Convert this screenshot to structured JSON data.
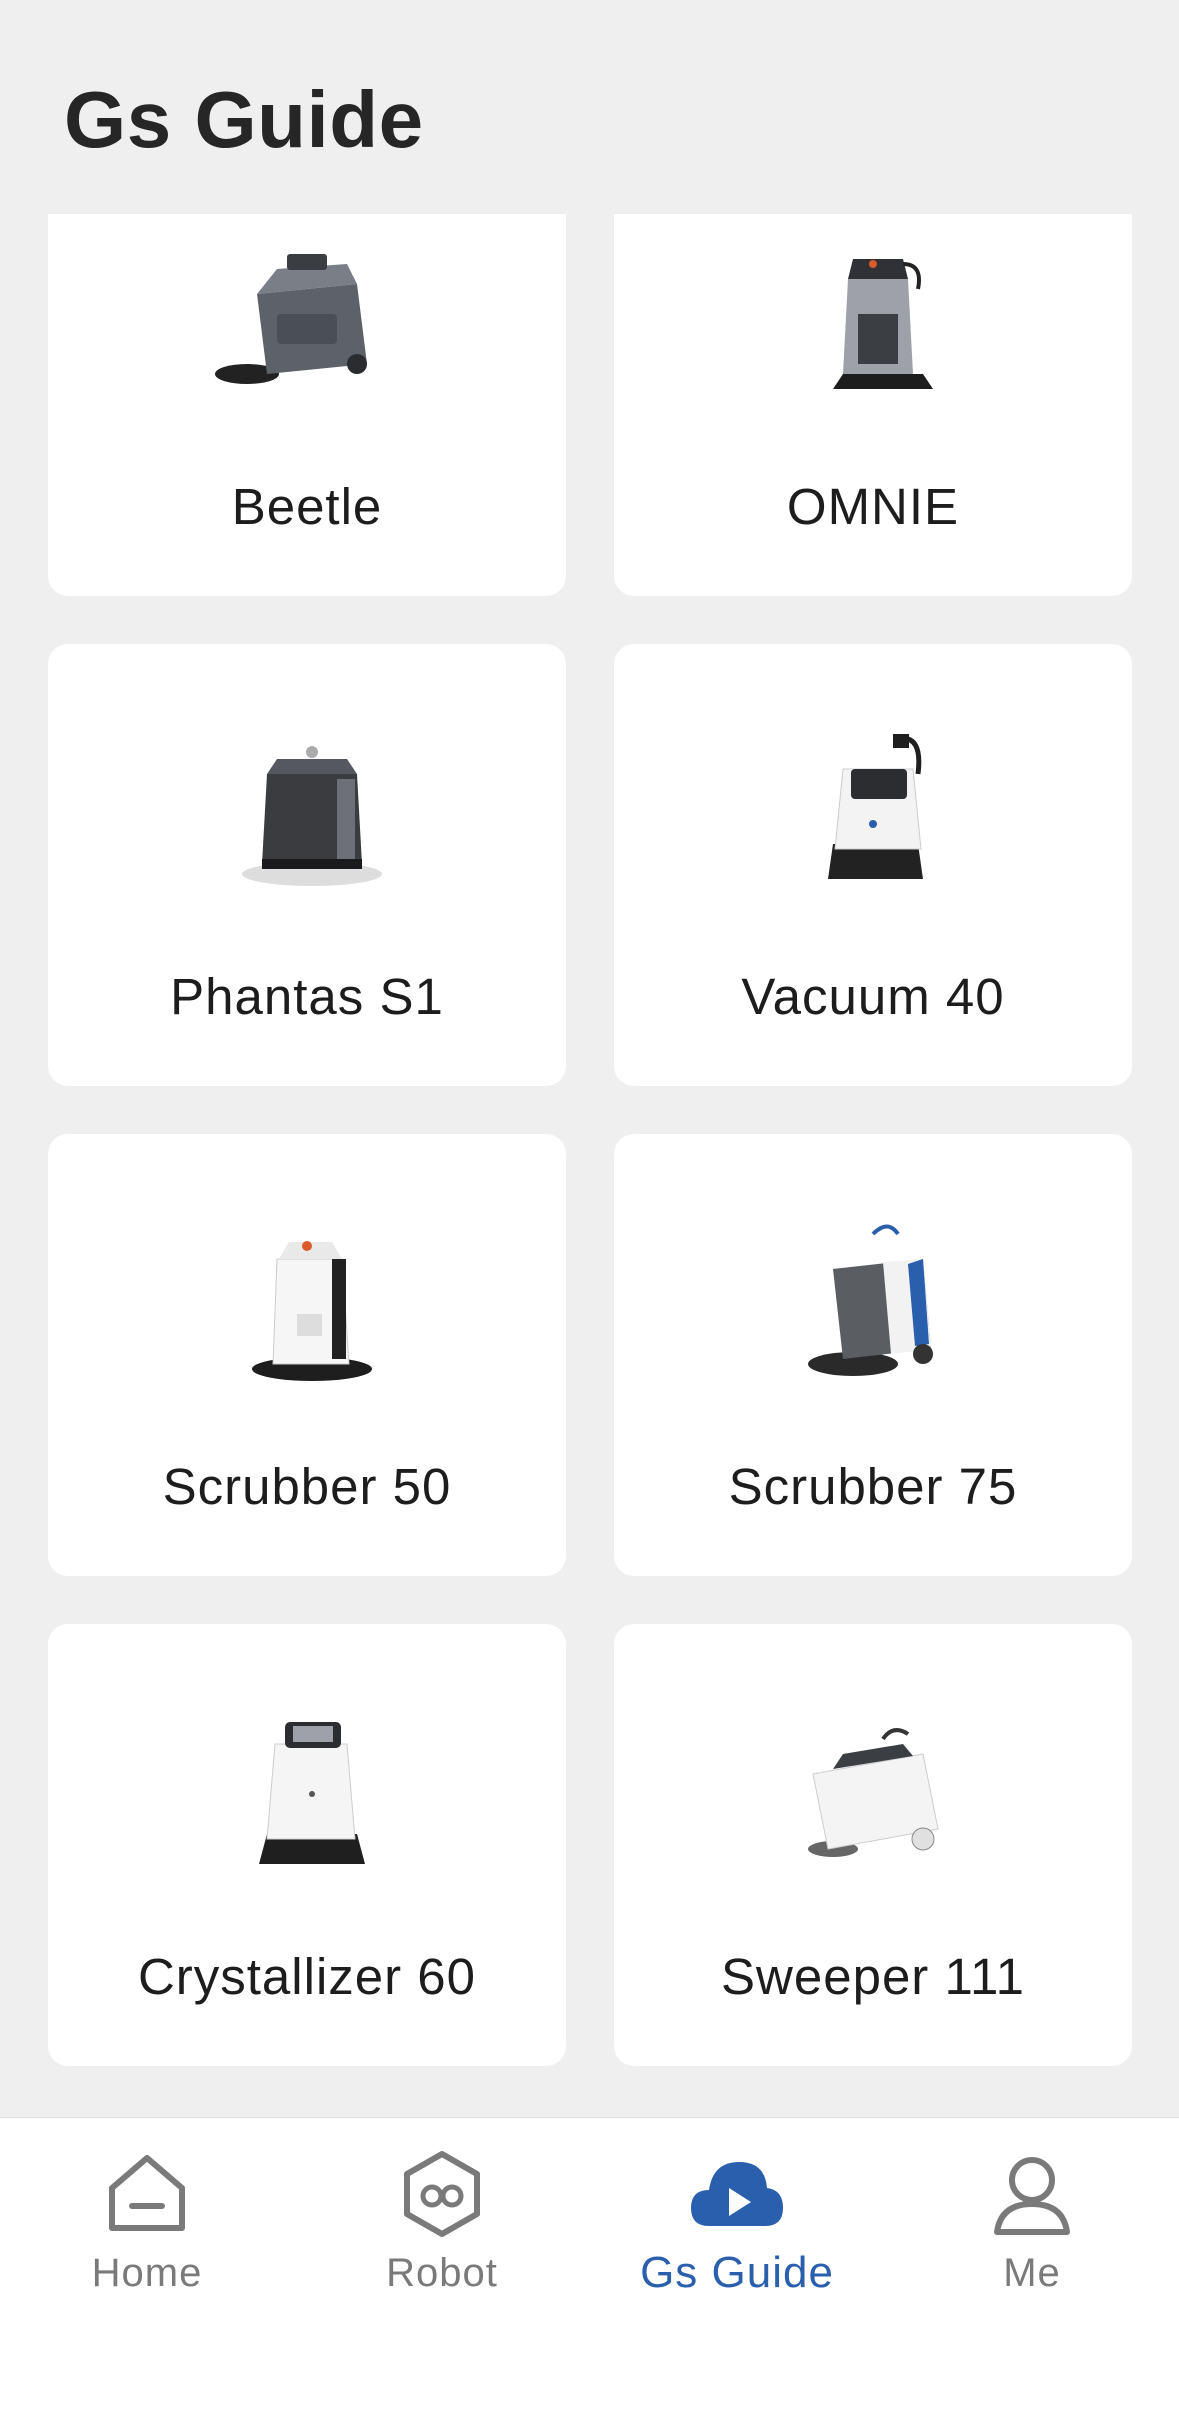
{
  "header": {
    "title": "Gs Guide"
  },
  "products": [
    {
      "name": "Beetle",
      "icon": "robot-beetle-icon"
    },
    {
      "name": "OMNIE",
      "icon": "robot-omnie-icon"
    },
    {
      "name": "Phantas S1",
      "icon": "robot-phantas-icon"
    },
    {
      "name": "Vacuum 40",
      "icon": "robot-vacuum40-icon"
    },
    {
      "name": "Scrubber 50",
      "icon": "robot-scrubber50-icon"
    },
    {
      "name": "Scrubber 75",
      "icon": "robot-scrubber75-icon"
    },
    {
      "name": "Crystallizer 60",
      "icon": "robot-crystallizer60-icon"
    },
    {
      "name": "Sweeper 111",
      "icon": "robot-sweeper111-icon"
    }
  ],
  "tabbar": {
    "items": [
      {
        "label": "Home",
        "icon": "home-icon",
        "active": false
      },
      {
        "label": "Robot",
        "icon": "robot-hexagon-icon",
        "active": false
      },
      {
        "label": "Gs Guide",
        "icon": "cloud-play-icon",
        "active": true
      },
      {
        "label": "Me",
        "icon": "person-icon",
        "active": false
      }
    ],
    "active_color": "#2a5fae",
    "inactive_color": "#7a7a7a"
  }
}
